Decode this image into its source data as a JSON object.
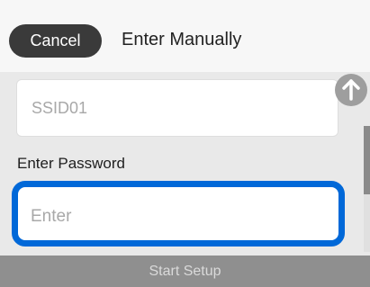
{
  "header": {
    "cancel_label": "Cancel",
    "title": "Enter Manually"
  },
  "ssid_field": {
    "value": "SSID01"
  },
  "password": {
    "label": "Enter Password",
    "placeholder": "Enter"
  },
  "footer": {
    "start_label": "Start Setup"
  },
  "icons": {
    "scroll_up": "arrow-up-icon"
  },
  "colors": {
    "focus_border": "#0068d8",
    "cancel_bg": "#3a3a3a",
    "bottom_bar": "#8f8f8f"
  }
}
